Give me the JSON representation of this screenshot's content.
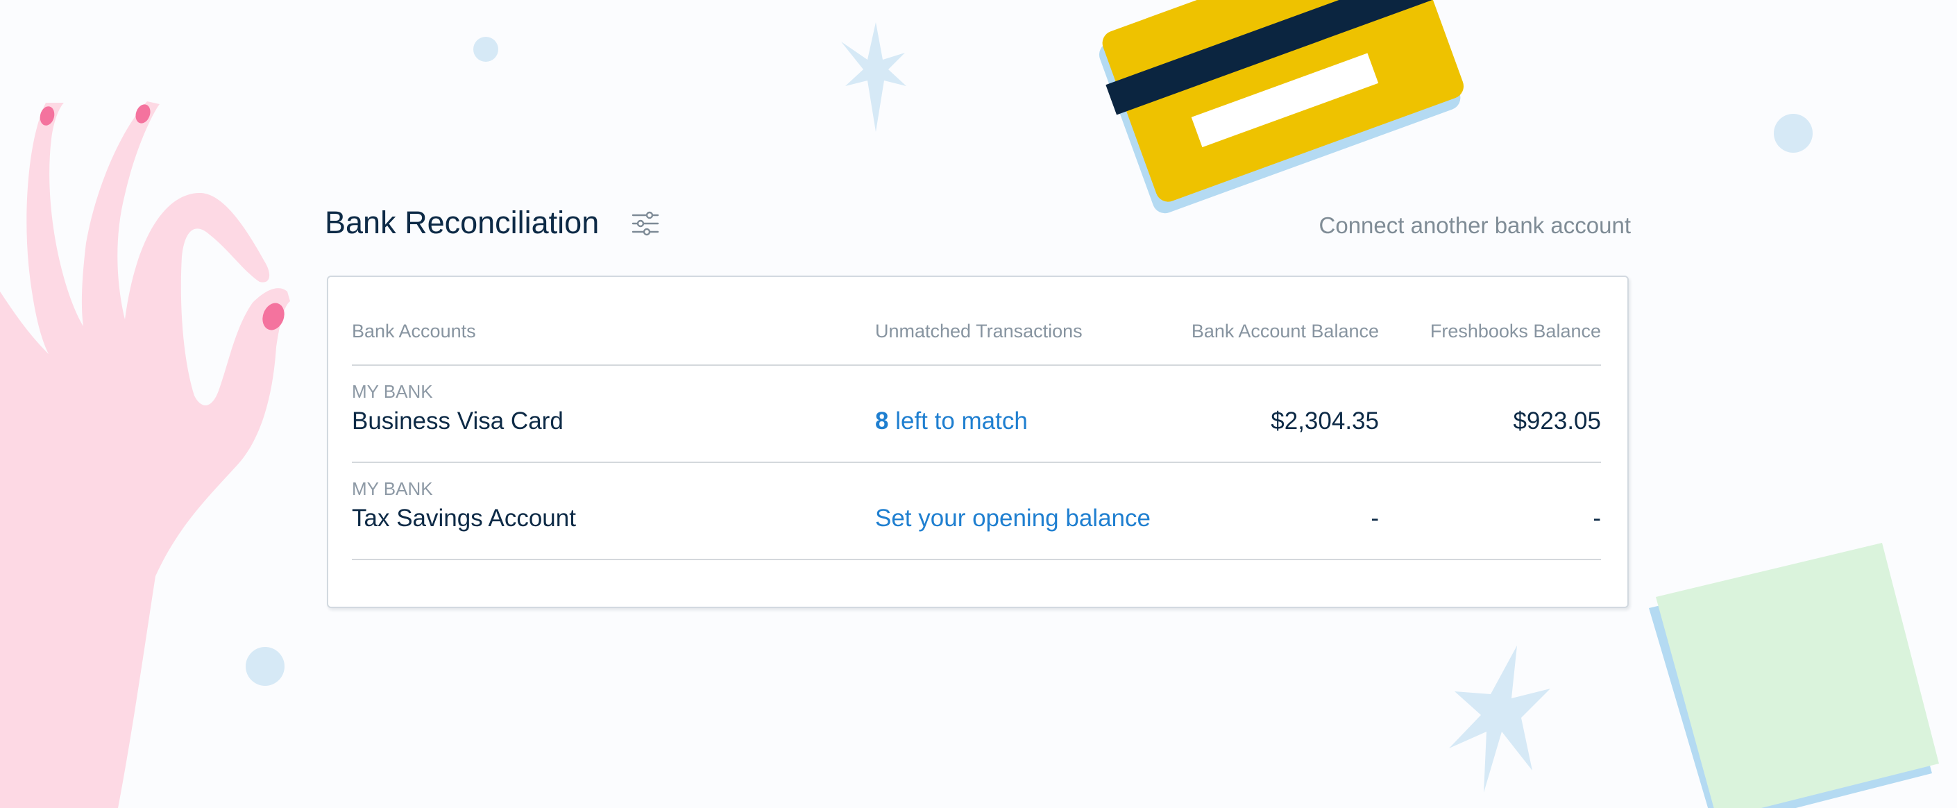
{
  "header": {
    "title": "Bank Reconciliation",
    "settings_icon": "sliders-icon",
    "connect_link": "Connect another bank account"
  },
  "table": {
    "columns": [
      "Bank Accounts",
      "Unmatched Transactions",
      "Bank Account Balance",
      "Freshbooks Balance"
    ],
    "rows": [
      {
        "bank": "MY BANK",
        "account": "Business Visa Card",
        "unmatched_count": "8",
        "unmatched_text": "left to match",
        "bank_balance": "$2,304.35",
        "freshbooks_balance": "$923.05"
      },
      {
        "bank": "MY BANK",
        "account": "Tax Savings Account",
        "unmatched_text": "Set your opening balance",
        "bank_balance": "-",
        "freshbooks_balance": "-"
      }
    ]
  },
  "colors": {
    "background": "#fbfcfe",
    "title": "#0d2a46",
    "muted": "#7f8c96",
    "link": "#1f7fd0",
    "border": "#d2d9e0",
    "hand": "#fdd9e4",
    "nail": "#f4739e",
    "card_yellow": "#eec200",
    "card_stripe": "#0b2540",
    "paper_green": "#daf3dc",
    "accent_blue": "#b4daf2",
    "sparkle": "#d6e9f6"
  }
}
